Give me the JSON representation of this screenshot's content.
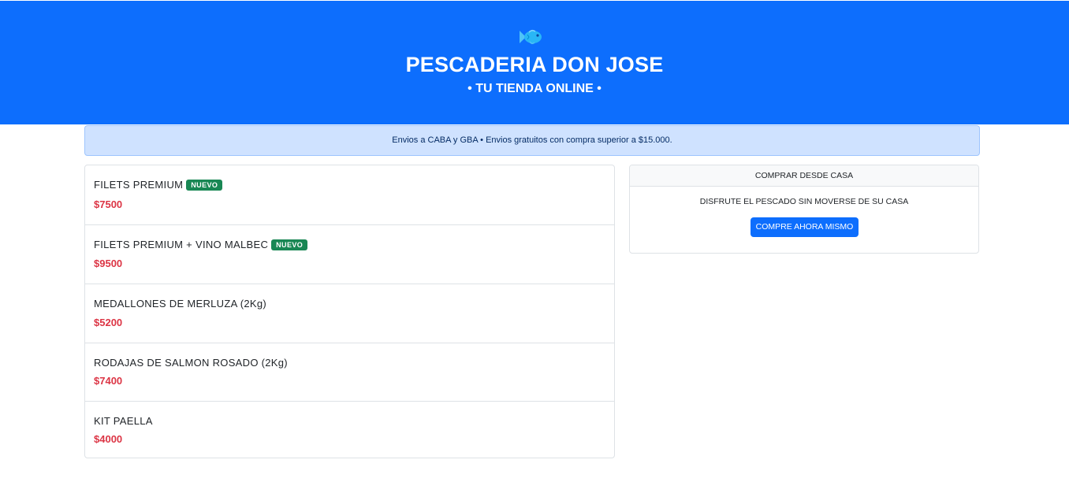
{
  "header": {
    "logo_icon": "fish-icon",
    "title": "PESCADERIA DON JOSE",
    "subtitle": "• TU TIENDA ONLINE •",
    "background": "#0d6efd"
  },
  "notice": {
    "text": "Envios a CABA y GBA • Envios gratuitos con compra superior a $15.000."
  },
  "products": [
    {
      "name": "FILETS PREMIUM",
      "badge": "NUEVO",
      "price": "$7500"
    },
    {
      "name": "FILETS PREMIUM + VINO MALBEC",
      "badge": "NUEVO",
      "price": "$9500"
    },
    {
      "name": "MEDALLONES DE MERLUZA (2Kg)",
      "badge": "",
      "price": "$5200"
    },
    {
      "name": "RODAJAS DE SALMON ROSADO (2Kg)",
      "badge": "",
      "price": "$7400"
    },
    {
      "name": "KIT PAELLA",
      "badge": "",
      "price": "$4000"
    }
  ],
  "buy_card": {
    "header": "COMPRAR DESDE CASA",
    "text": "DISFRUTE EL PESCADO SIN MOVERSE DE SU CASA",
    "button_label": "COMPRE AHORA MISMO"
  },
  "colors": {
    "primary": "#0d6efd",
    "price": "#dc3545",
    "badge": "#198754",
    "alert_bg": "#cfe2ff"
  }
}
